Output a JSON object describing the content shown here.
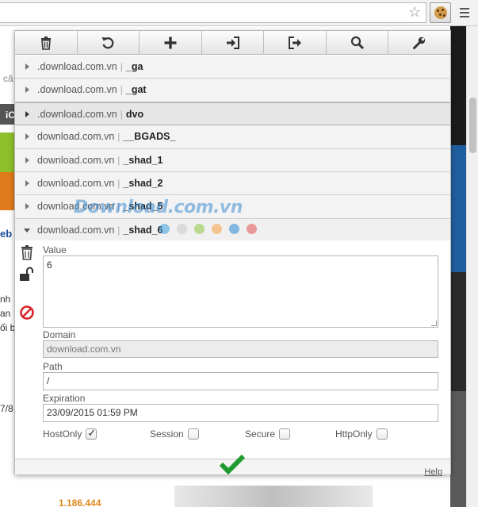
{
  "browser": {
    "bookmark_icon": "star-outline-icon",
    "extension_icon": "cookie-icon",
    "menu_icon": "hamburger-menu-icon"
  },
  "background_page": {
    "left_fragments": [
      "că",
      "iC",
      "eb",
      "nh",
      "an",
      "ối b",
      "7/8"
    ],
    "price": "1.186.444"
  },
  "toolbar": [
    {
      "name": "delete-all",
      "icon": "trash-icon"
    },
    {
      "name": "reset",
      "icon": "undo-icon"
    },
    {
      "name": "add",
      "icon": "plus-icon"
    },
    {
      "name": "import",
      "icon": "sign-in-icon"
    },
    {
      "name": "export",
      "icon": "sign-out-icon"
    },
    {
      "name": "search",
      "icon": "search-icon"
    },
    {
      "name": "options",
      "icon": "wrench-icon"
    }
  ],
  "cookies": [
    {
      "domain": ".download.com.vn",
      "name": "_ga",
      "state": "collapsed"
    },
    {
      "domain": ".download.com.vn",
      "name": "_gat",
      "state": "collapsed"
    },
    {
      "domain": ".download.com.vn",
      "name": "dvo",
      "state": "collapsed-highlight"
    },
    {
      "domain": "download.com.vn",
      "name": "__BGADS_",
      "state": "collapsed"
    },
    {
      "domain": "download.com.vn",
      "name": "_shad_1",
      "state": "collapsed"
    },
    {
      "domain": "download.com.vn",
      "name": "_shad_2",
      "state": "collapsed"
    },
    {
      "domain": "download.com.vn",
      "name": "_shad_5",
      "state": "collapsed"
    },
    {
      "domain": "download.com.vn",
      "name": "_shad_6",
      "state": "expanded"
    }
  ],
  "separator": "|",
  "editor": {
    "value_label": "Value",
    "value": "6",
    "domain_label": "Domain",
    "domain": "download.com.vn",
    "path_label": "Path",
    "path": "/",
    "expiration_label": "Expiration",
    "expiration": "23/09/2015 01:59 PM",
    "flags": [
      {
        "label": "HostOnly",
        "checked": true
      },
      {
        "label": "Session",
        "checked": false
      },
      {
        "label": "Secure",
        "checked": false
      },
      {
        "label": "HttpOnly",
        "checked": false
      }
    ],
    "side_icons": [
      "trash-icon",
      "unlock-icon",
      "block-icon"
    ]
  },
  "footer": {
    "submit_icon": "checkmark-icon",
    "help_label": "Help"
  },
  "watermark": {
    "text": "Download.com.vn",
    "dot_colors": [
      "#3ca0e0",
      "#d0d0d0",
      "#8cc63f",
      "#f6a03c",
      "#2e8bd6",
      "#e05050"
    ]
  },
  "colors": {
    "accent_check": "#1f9a2f",
    "block_red": "#d8242a"
  }
}
